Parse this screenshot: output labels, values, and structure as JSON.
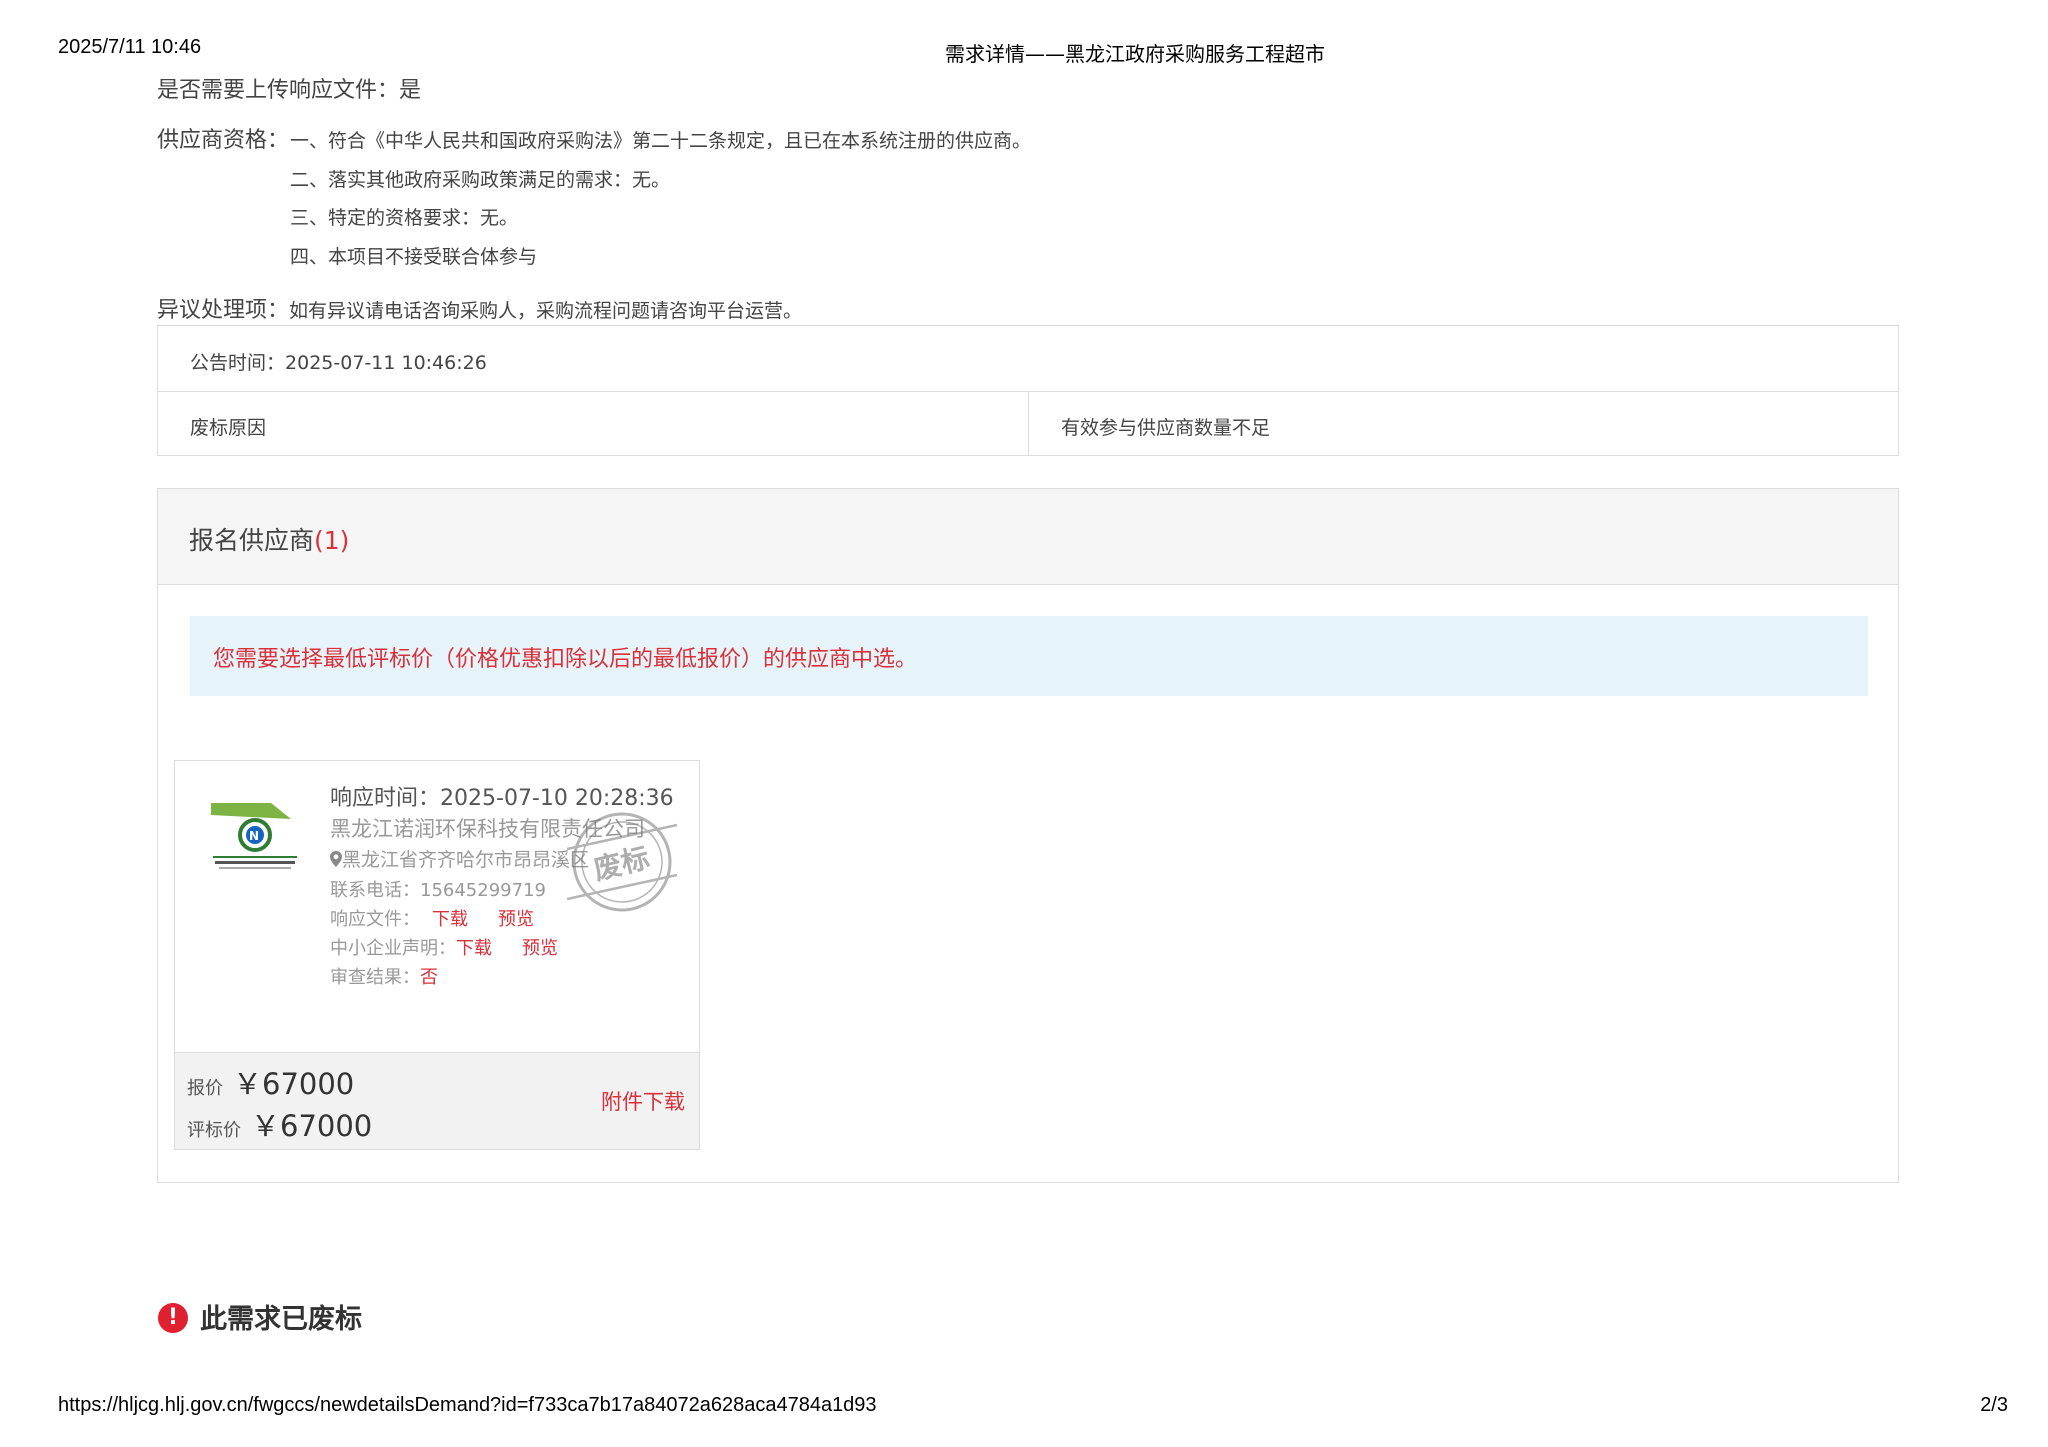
{
  "header": {
    "datetime": "2025/7/11 10:46",
    "title": "需求详情——黑龙江政府采购服务工程超市"
  },
  "details": {
    "upload_required_label": "是否需要上传响应文件：",
    "upload_required_value": "是",
    "qualification_label": "供应商资格：",
    "qualifications": [
      "一、符合《中华人民共和国政府采购法》第二十二条规定，且已在本系统注册的供应商。",
      "二、落实其他政府采购政策满足的需求：无。",
      "三、特定的资格要求：无。",
      "四、本项目不接受联合体参与"
    ],
    "objection_label": "异议处理项：",
    "objection_value": "如有异议请电话咨询采购人，采购流程问题请咨询平台运营。"
  },
  "announcement": {
    "time_label": "公告时间：",
    "time_value": "2025-07-11 10:46:26",
    "reason_label": "废标原因",
    "reason_value": "有效参与供应商数量不足"
  },
  "suppliers": {
    "title": "报名供应商",
    "count": "(1)",
    "notice": "您需要选择最低评标价（价格优惠扣除以后的最低报价）的供应商中选。",
    "card": {
      "response_time_label": "响应时间：",
      "response_time": "2025-07-10 20:28:36",
      "company": "黑龙江诺润环保科技有限责任公司",
      "address": "黑龙江省齐齐哈尔市昂昂溪区",
      "phone_label": "联系电话：",
      "phone": "15645299719",
      "response_file_label": "响应文件：",
      "sme_label": "中小企业声明：",
      "download": "下载",
      "preview": "预览",
      "review_label": "审查结果：",
      "review_value": "否",
      "stamp_text": "废标",
      "price_label": "报价",
      "price_value": "￥67000",
      "eval_label": "评标价",
      "eval_value": "￥67000",
      "attachment": "附件下载"
    }
  },
  "status": {
    "message": "此需求已废标",
    "icon": "!"
  },
  "footer": {
    "url": "https://hljcg.hlj.gov.cn/fwgccs/newdetailsDemand?id=f733ca7b17a84072a628aca4784a1d93",
    "page": "2/3"
  },
  "colors": {
    "accent_red": "#d9303a",
    "notice_bg": "#e6f3f9",
    "panel_head_bg": "#f5f5f5"
  }
}
